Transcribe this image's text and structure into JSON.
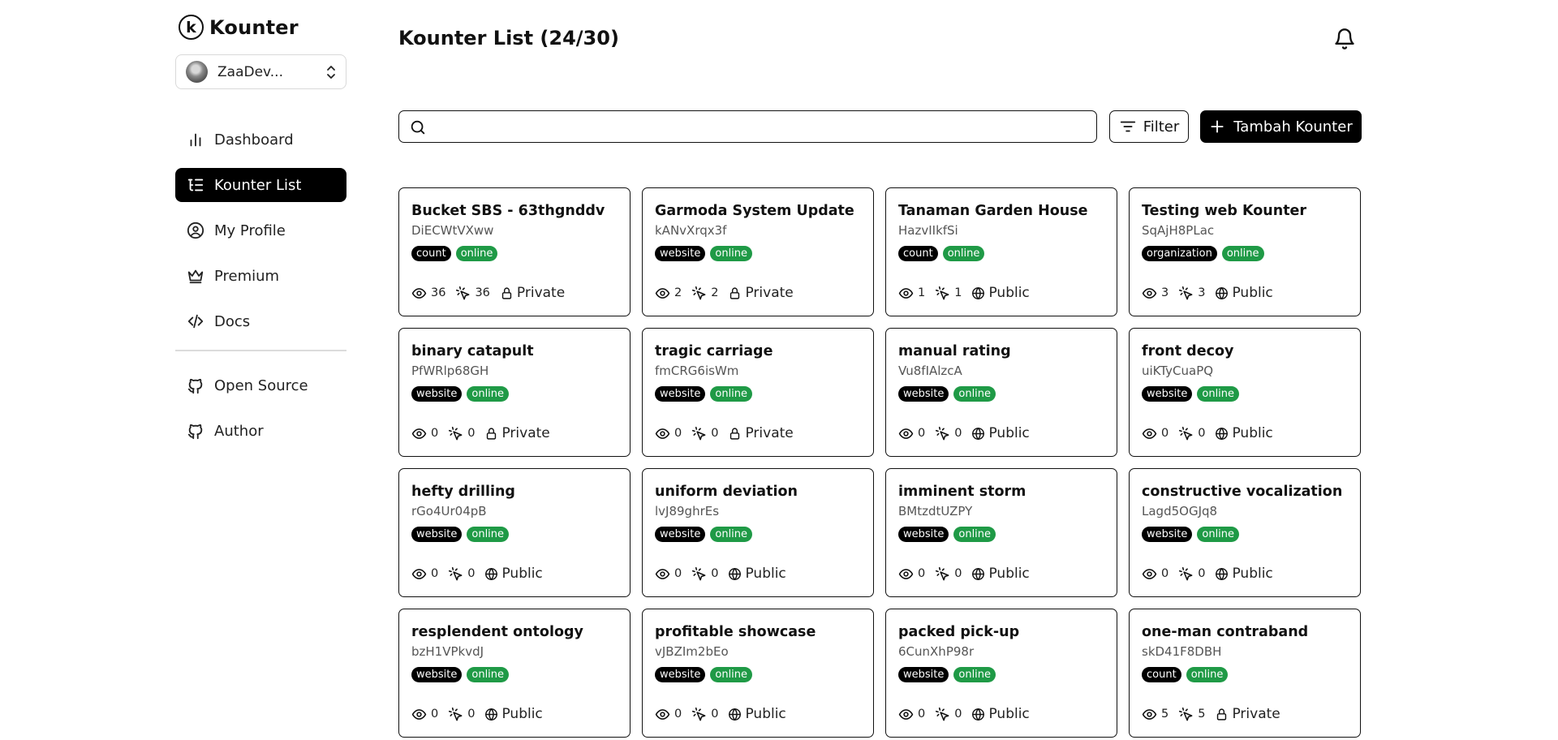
{
  "app": {
    "name": "Kounter",
    "logo_letter": "k"
  },
  "account": {
    "name": "ZaaDev..."
  },
  "nav": [
    {
      "label": "Dashboard",
      "icon": "bar-chart-icon",
      "active": false
    },
    {
      "label": "Kounter List",
      "icon": "list-icon",
      "active": true
    },
    {
      "label": "My Profile",
      "icon": "user-circle-icon",
      "active": false
    },
    {
      "label": "Premium",
      "icon": "crown-icon",
      "active": false
    },
    {
      "label": "Docs",
      "icon": "code-icon",
      "active": false
    }
  ],
  "nav_secondary": [
    {
      "label": "Open Source",
      "icon": "github-icon"
    },
    {
      "label": "Author",
      "icon": "github-icon"
    }
  ],
  "main": {
    "title": "Kounter List (24/30)",
    "search_placeholder": "",
    "filter_label": "Filter",
    "add_label": "Tambah Kounter"
  },
  "colors": {
    "online": "#1f9a46",
    "primary": "#000000"
  },
  "cards": [
    {
      "title": "Bucket SBS - 63thgnddv",
      "id": "DiECWtVXww",
      "type": "count",
      "status": "online",
      "views": "36",
      "clicks": "36",
      "visibility": "Private"
    },
    {
      "title": "Garmoda System Update",
      "id": "kANvXrqx3f",
      "type": "website",
      "status": "online",
      "views": "2",
      "clicks": "2",
      "visibility": "Private"
    },
    {
      "title": "Tanaman Garden House",
      "id": "HazvIIkfSi",
      "type": "count",
      "status": "online",
      "views": "1",
      "clicks": "1",
      "visibility": "Public"
    },
    {
      "title": "Testing web Kounter",
      "id": "SqAjH8PLac",
      "type": "organization",
      "status": "online",
      "views": "3",
      "clicks": "3",
      "visibility": "Public"
    },
    {
      "title": "binary catapult",
      "id": "PfWRlp68GH",
      "type": "website",
      "status": "online",
      "views": "0",
      "clicks": "0",
      "visibility": "Private"
    },
    {
      "title": "tragic carriage",
      "id": "fmCRG6isWm",
      "type": "website",
      "status": "online",
      "views": "0",
      "clicks": "0",
      "visibility": "Private"
    },
    {
      "title": "manual rating",
      "id": "Vu8fIAlzcA",
      "type": "website",
      "status": "online",
      "views": "0",
      "clicks": "0",
      "visibility": "Public"
    },
    {
      "title": "front decoy",
      "id": "uiKTyCuaPQ",
      "type": "website",
      "status": "online",
      "views": "0",
      "clicks": "0",
      "visibility": "Public"
    },
    {
      "title": "hefty drilling",
      "id": "rGo4Ur04pB",
      "type": "website",
      "status": "online",
      "views": "0",
      "clicks": "0",
      "visibility": "Public"
    },
    {
      "title": "uniform deviation",
      "id": "lvJ89ghrEs",
      "type": "website",
      "status": "online",
      "views": "0",
      "clicks": "0",
      "visibility": "Public"
    },
    {
      "title": "imminent storm",
      "id": "BMtzdtUZPY",
      "type": "website",
      "status": "online",
      "views": "0",
      "clicks": "0",
      "visibility": "Public"
    },
    {
      "title": "constructive vocalization",
      "id": "Lagd5OGJq8",
      "type": "website",
      "status": "online",
      "views": "0",
      "clicks": "0",
      "visibility": "Public"
    },
    {
      "title": "resplendent ontology",
      "id": "bzH1VPkvdJ",
      "type": "website",
      "status": "online",
      "views": "0",
      "clicks": "0",
      "visibility": "Public"
    },
    {
      "title": "profitable showcase",
      "id": "vJBZIm2bEo",
      "type": "website",
      "status": "online",
      "views": "0",
      "clicks": "0",
      "visibility": "Public"
    },
    {
      "title": "packed pick-up",
      "id": "6CunXhP98r",
      "type": "website",
      "status": "online",
      "views": "0",
      "clicks": "0",
      "visibility": "Public"
    },
    {
      "title": "one-man contraband",
      "id": "skD41F8DBH",
      "type": "count",
      "status": "online",
      "views": "5",
      "clicks": "5",
      "visibility": "Private"
    }
  ]
}
